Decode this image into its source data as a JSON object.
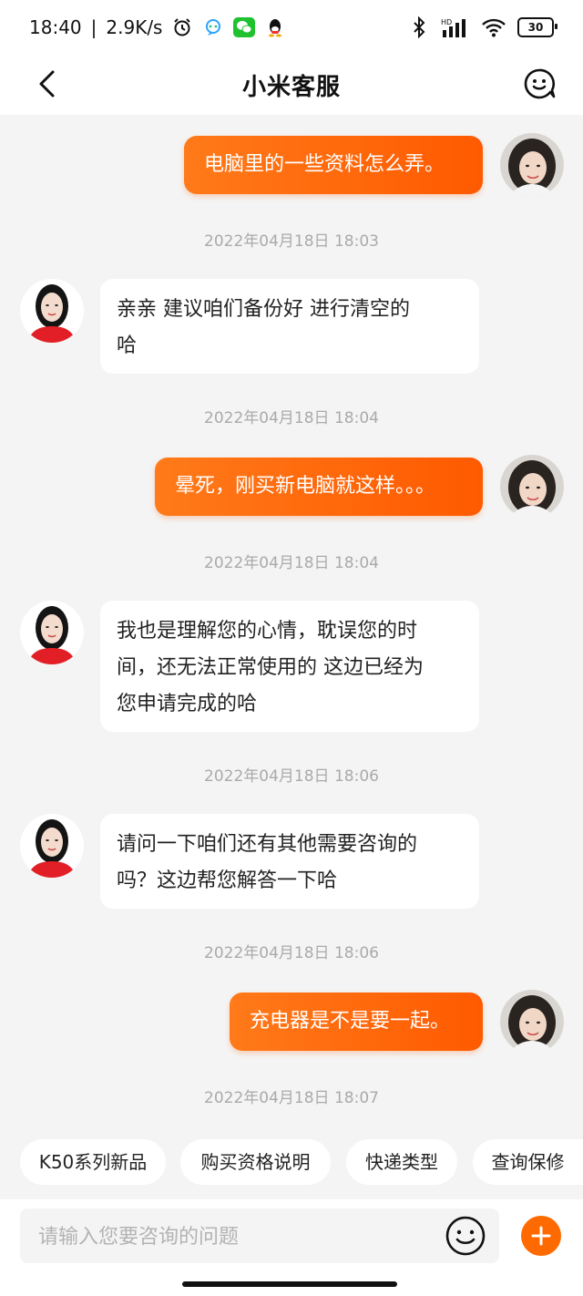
{
  "status_bar": {
    "time": "18:40",
    "speed": "2.9K/s",
    "battery": "30",
    "icons": [
      "alarm-icon",
      "cloud-chat-icon",
      "wechat-icon",
      "qq-icon",
      "bluetooth-icon",
      "signal-icon",
      "wifi-icon",
      "battery-icon"
    ]
  },
  "header": {
    "title": "小米客服"
  },
  "messages": [
    {
      "side": "out",
      "text": "电脑里的一些资料怎么弄。"
    },
    {
      "time": "2022年04月18日 18:03"
    },
    {
      "side": "in",
      "lines": [
        "亲亲 建议咱们备份好 进行清空的",
        "哈"
      ]
    },
    {
      "time": "2022年04月18日 18:04"
    },
    {
      "side": "out",
      "text": "晕死，刚买新电脑就这样。。。"
    },
    {
      "time": "2022年04月18日 18:04"
    },
    {
      "side": "in",
      "lines": [
        "我也是理解您的心情，耽误您的时",
        "间，还无法正常使用的 这边已经为",
        "您申请完成的哈"
      ]
    },
    {
      "time": "2022年04月18日 18:06"
    },
    {
      "side": "in",
      "lines": [
        "请问一下咱们还有其他需要咨询的",
        "吗？这边帮您解答一下哈"
      ]
    },
    {
      "time": "2022年04月18日 18:06"
    },
    {
      "side": "out",
      "text": "充电器是不是要一起。"
    },
    {
      "time": "2022年04月18日 18:07"
    }
  ],
  "quick_replies": [
    "K50系列新品",
    "购买资格说明",
    "快递类型",
    "查询保修"
  ],
  "input": {
    "placeholder": "请输入您要咨询的问题",
    "value": ""
  },
  "colors": {
    "accent": "#ff6a00",
    "bubble_out": "#ff6a0f",
    "background": "#f4f4f4"
  }
}
